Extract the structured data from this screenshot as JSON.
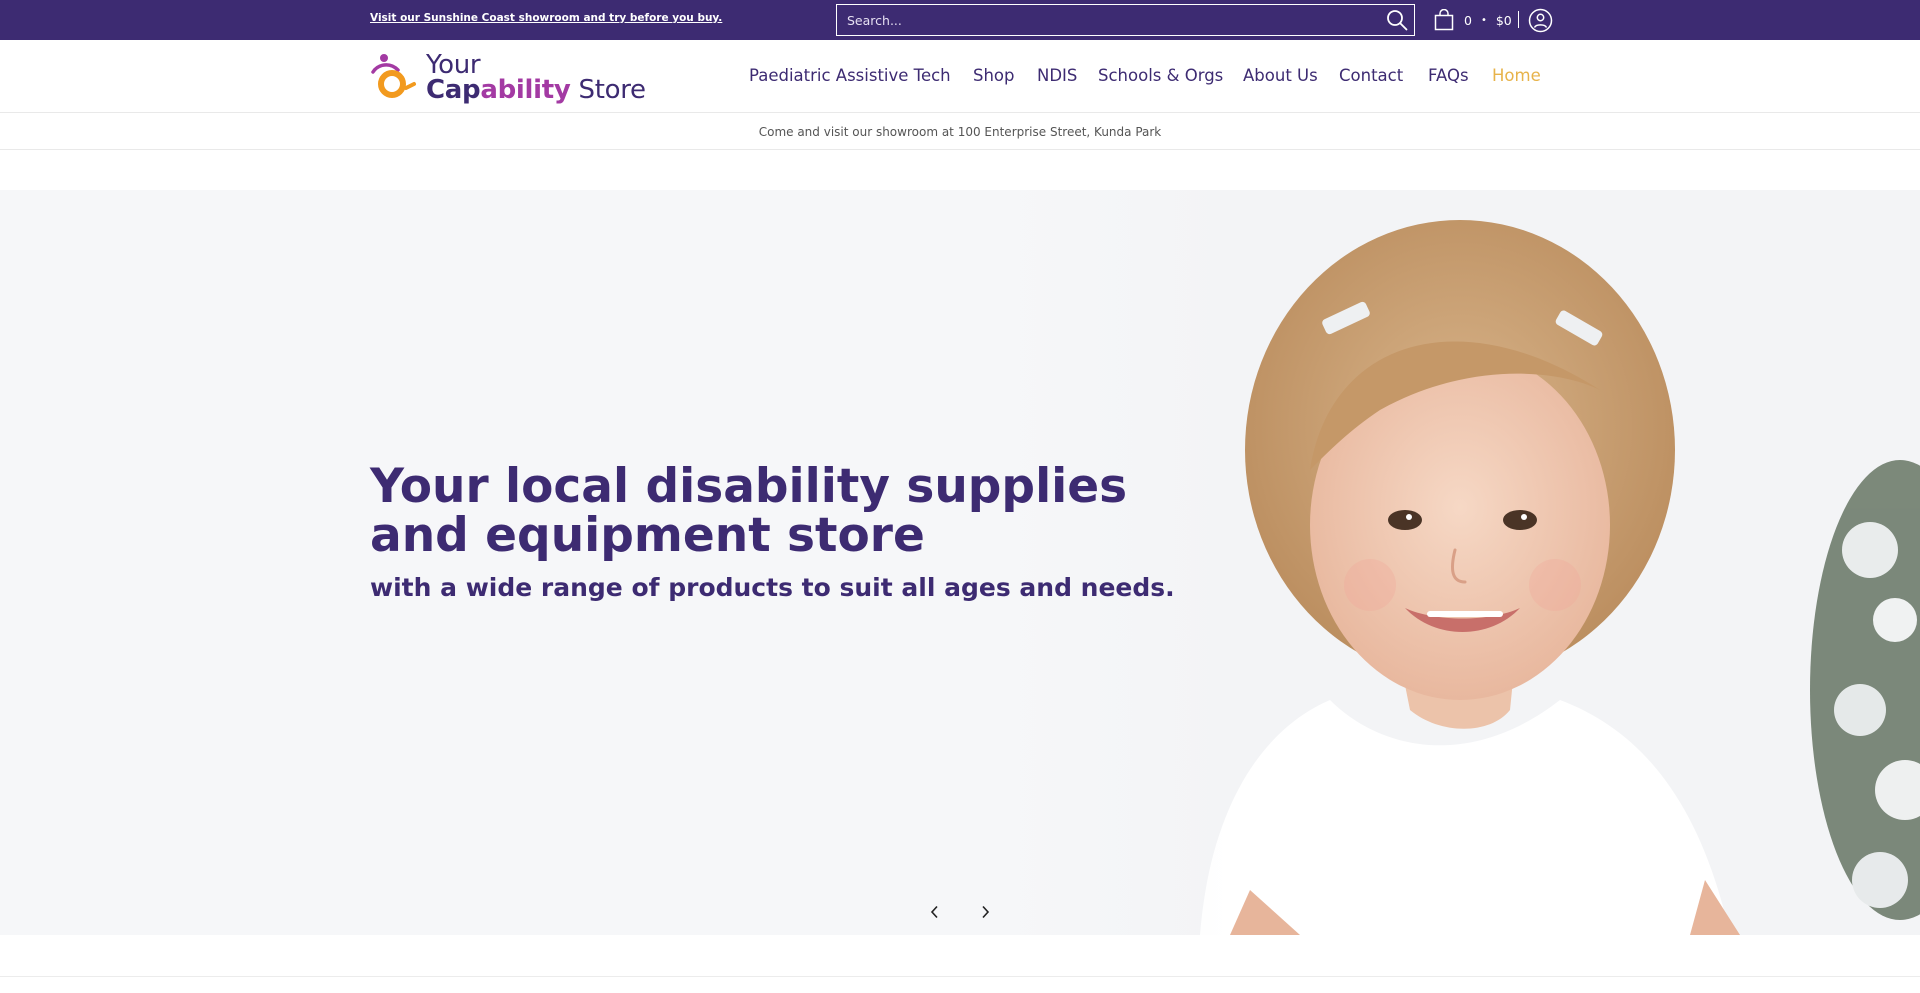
{
  "topbar": {
    "promo_link": "Visit our Sunshine Coast showroom and try before you buy.",
    "search_placeholder": "Search...",
    "cart_count": "0",
    "cart_separator": "•",
    "cart_total": "$0",
    "icons": [
      "search-icon",
      "shopping-bag-icon",
      "account-icon"
    ],
    "background": "#3d2b72"
  },
  "header": {
    "logo": {
      "line1": "Your",
      "cap": "Cap",
      "ability": "ability",
      "store": "Store"
    },
    "nav": [
      {
        "label": "Paediatric Assistive Tech"
      },
      {
        "label": "Shop"
      },
      {
        "label": "NDIS"
      },
      {
        "label": "Schools & Orgs"
      },
      {
        "label": "About Us"
      },
      {
        "label": "Contact"
      },
      {
        "label": "FAQs"
      },
      {
        "label": "Home",
        "active": true
      }
    ]
  },
  "announcement": {
    "text": "Come and visit our showroom at 100 Enterprise Street, Kunda Park"
  },
  "hero": {
    "title": "Your local disability supplies and equipment store",
    "subtitle": "with a wide range of products to suit all ages and needs.",
    "arrows": [
      "chevron-left-icon",
      "chevron-right-icon"
    ]
  },
  "colors": {
    "brand_purple": "#3d2b72",
    "brand_magenta": "#a33aa3",
    "brand_orange": "#f29a1e",
    "active_nav": "#e7b34a"
  }
}
